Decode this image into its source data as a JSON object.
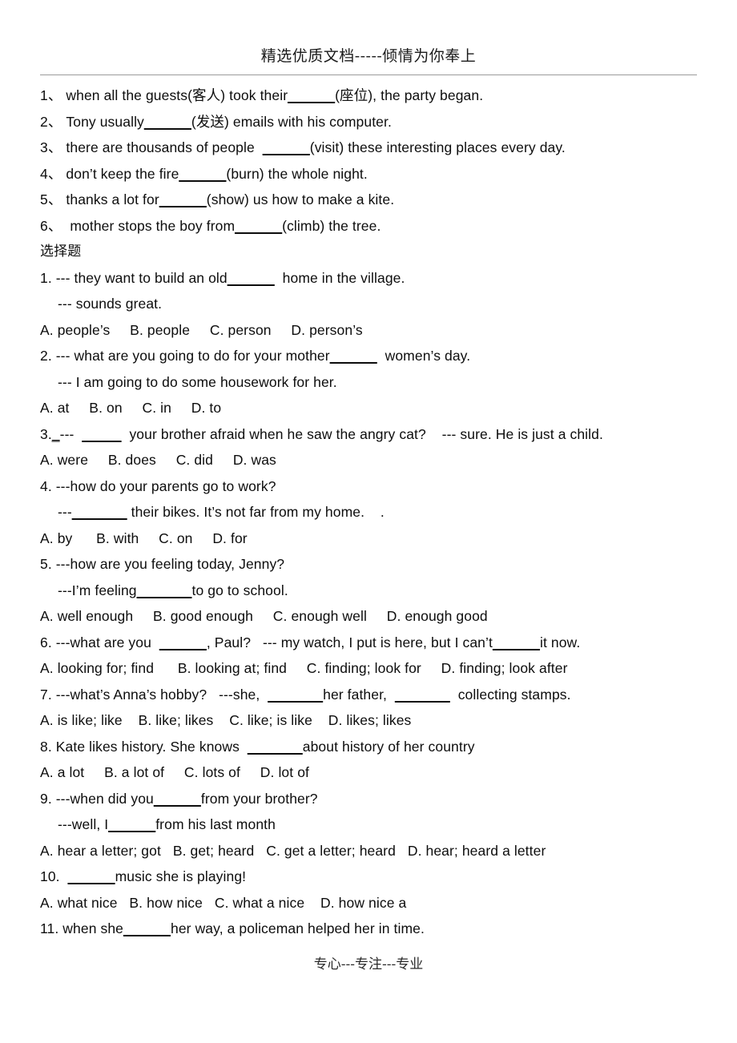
{
  "document": {
    "header_text": "精选优质文档-----倾情为你奉上",
    "footer_text": "专心---专注---专业",
    "rule_color": "#9b9b9b"
  },
  "fill_in_section": {
    "items": [
      {
        "num": "1、",
        "pre": " when all the guests(客人) took their",
        "blank": "______",
        "post": "(座位), the party began."
      },
      {
        "num": "2、",
        "pre": " Tony usually",
        "blank": "______",
        "post": "(发送) emails with his computer."
      },
      {
        "num": "3、",
        "pre": " there are thousands of people  ",
        "blank": "______",
        "post": "(visit) these interesting places every day."
      },
      {
        "num": "4、",
        "pre": " don’t keep the fire",
        "blank": "______",
        "post": "(burn) the whole night."
      },
      {
        "num": "5、",
        "pre": " thanks a lot for",
        "blank": "______",
        "post": "(show) us how to make a kite."
      },
      {
        "num": "6、",
        "pre": "  mother stops the boy from",
        "blank": "______",
        "post": "(climb) the tree."
      }
    ]
  },
  "choice_section": {
    "heading": "选择题",
    "q1": {
      "stem_pre": "1. --- they want to build an old",
      "stem_blank": "______",
      "stem_post": "  home in the village.",
      "reply": "--- sounds great.",
      "options": "A. people’s     B. people     C. person     D. person’s"
    },
    "q2": {
      "stem_pre": "2. --- what are you going to do for your mother",
      "stem_blank": "______",
      "stem_post": "  women’s day.",
      "reply": "--- I am going to do some housework for her.",
      "options": "A. at     B. on     C. in     D. to"
    },
    "q3": {
      "stem_num": "3.",
      "stem_tiny_blank": "_",
      "stem_pre": "---  ",
      "stem_blank": "_____",
      "stem_post": "  your brother afraid when he saw the angry cat?    --- sure. He is just a child.",
      "options": "A. were     B. does     C. did     D. was"
    },
    "q4": {
      "stem": "4. ---how do your parents go to work?",
      "reply_pre": "---",
      "reply_blank": "_______",
      "reply_post": " their bikes. It’s not far from my home.    .",
      "options": "A. by      B. with     C. on     D. for"
    },
    "q5": {
      "stem": "5. ---how are you feeling today, Jenny?",
      "reply_pre": "---I’m feeling",
      "reply_blank": "_______",
      "reply_post": "to go to school.",
      "options": "A. well enough     B. good enough     C. enough well     D. enough good"
    },
    "q6": {
      "stem_pre": "6. ---what are you  ",
      "stem_blank1": "______",
      "stem_mid": ", Paul?   --- my watch, I put is here, but I can’t",
      "stem_blank2": "______",
      "stem_post": "it now.",
      "options": "A. looking for; find      B. looking at; find     C. finding; look for     D. finding; look after"
    },
    "q7": {
      "stem_pre": "7. ---what’s Anna’s hobby?   ---she,  ",
      "stem_blank1": "_______",
      "stem_mid": "her father,  ",
      "stem_blank2": "_______",
      "stem_post": "  collecting stamps.",
      "options": "A. is like; like    B. like; likes    C. like; is like    D. likes; likes"
    },
    "q8": {
      "stem_pre": "8. Kate likes history. She knows  ",
      "stem_blank": "_______",
      "stem_post": "about history of her country",
      "options": "A. a lot     B. a lot of     C. lots of     D. lot of"
    },
    "q9": {
      "stem_pre": "9. ---when did you",
      "stem_blank": "______",
      "stem_post": "from your brother?",
      "reply_pre": "---well, I",
      "reply_blank": "______",
      "reply_post": "from his last month",
      "options": "A. hear a letter; got   B. get; heard   C. get a letter; heard   D. hear; heard a letter"
    },
    "q10": {
      "stem_pre": "10.  ",
      "stem_blank": "______",
      "stem_post": "music she is playing!",
      "options": "A. what nice   B. how nice   C. what a nice    D. how nice a"
    },
    "q11": {
      "stem_pre": "11. when she",
      "stem_blank": "______",
      "stem_post": "her way, a policeman helped her in time."
    }
  }
}
